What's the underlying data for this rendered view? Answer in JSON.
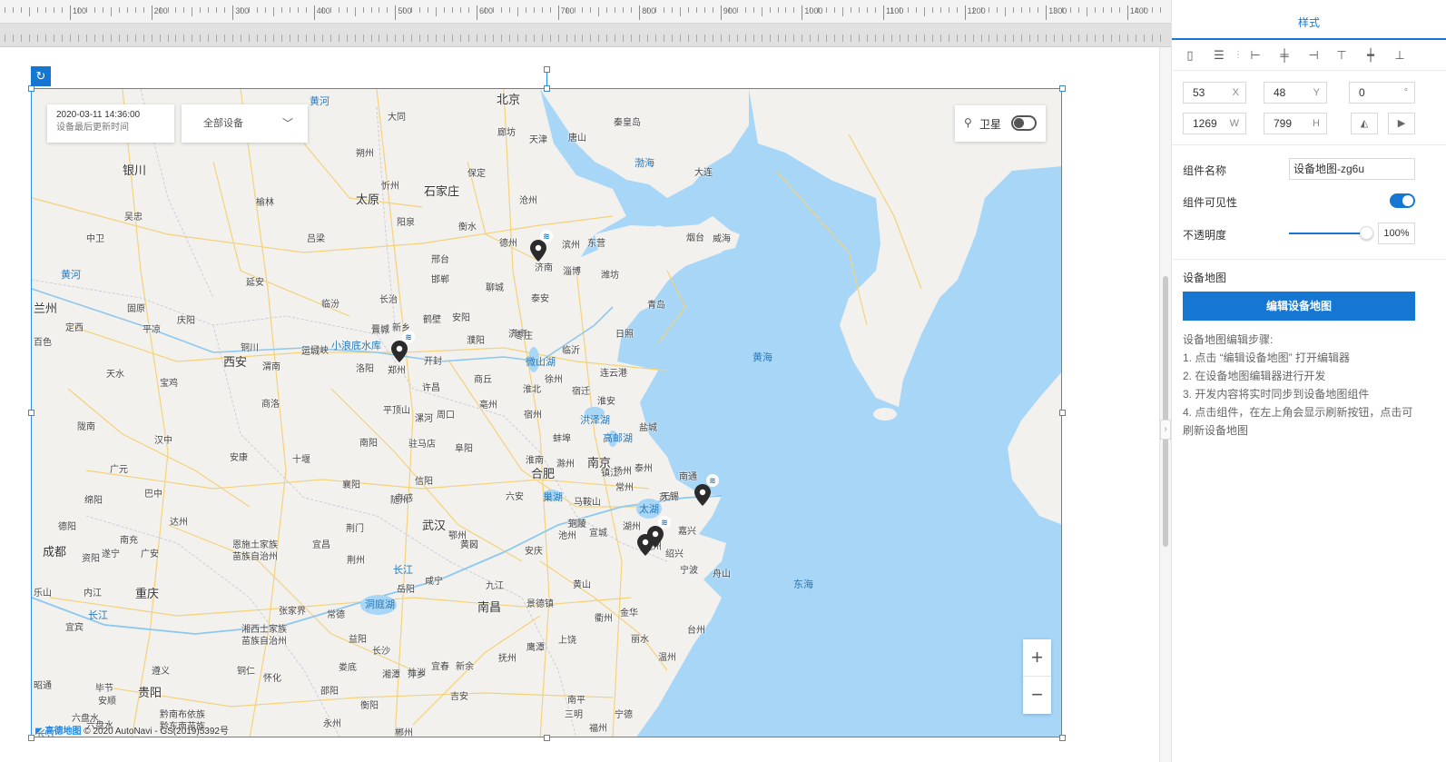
{
  "ruler": {
    "labels": [
      "100",
      "200",
      "300",
      "400",
      "500",
      "600",
      "700",
      "800",
      "900",
      "1000",
      "1100",
      "1200",
      "1300",
      "1400"
    ]
  },
  "map": {
    "info_time": "2020-03-11 14:36:00",
    "info_sub": "设备最后更新时间",
    "device_select": "全部设备",
    "satellite_label": "卫星",
    "satellite_on": false,
    "zoom_in": "+",
    "zoom_out": "−",
    "attribution_logo": "高德地图",
    "attribution_text": "© 2020 AutoNavi - GS(2019)5392号",
    "water_color": "#a7d6f7",
    "land_color": "#f2f1ee",
    "road_color": "#f4d27a",
    "pin_color": "#2b2b2b",
    "labels": {
      "beijing": "北京",
      "tianjin": "天津",
      "tangshan": "唐山",
      "qinhuangdao": "秦皇岛",
      "langfang": "廊坊",
      "baoding": "保定",
      "shijiazhuang": "石家庄",
      "cangzhou": "沧州",
      "taiyuan": "太原",
      "datong": "大同",
      "xinzhou": "忻州",
      "shuozhou": "朔州",
      "yangquan": "阳泉",
      "luliang": "吕梁",
      "yinchuan": "银川",
      "wuzhong": "吴忠",
      "yulin": "榆林",
      "yanan": "延安",
      "zhongwei": "中卫",
      "lanzhou": "兰州",
      "dingxi": "定西",
      "pingliang": "平凉",
      "qingyang": "庆阳",
      "guyuan": "固原",
      "tongchuan": "铜川",
      "xian": "西安",
      "weinan": "渭南",
      "tianshui": "天水",
      "baoji": "宝鸡",
      "shangluo": "商洛",
      "longnan": "陇南",
      "hanzhong": "汉中",
      "ankang": "安康",
      "guangyuan": "广元",
      "bazhong": "巴中",
      "mianyang": "绵阳",
      "dazhou": "达州",
      "nanchong": "南充",
      "guangan": "广安",
      "deyang": "德阳",
      "chengdu": "成都",
      "ziyang": "资阳",
      "suining": "遂宁",
      "leshan": "乐山",
      "neijiang": "内江",
      "chongqing": "重庆",
      "yibin": "宜宾",
      "zunyi": "遵义",
      "bijie": "毕节",
      "guiyang": "贵阳",
      "zhaotong": "昭通",
      "liupanshui": "六盘水",
      "qiannan": "黔南布依族",
      "tongren": "铜仁",
      "huaihua": "怀化",
      "shaoyang": "邵阳",
      "loudi": "娄底",
      "changsha": "长沙",
      "xiangtan": "湘潭",
      "zhuzhou": "株洲",
      "hengyang": "衡阳",
      "yongzhou": "永州",
      "chenzhou": "郴州",
      "pingxiang": "萍乡",
      "yichun": "宜春",
      "xinyu": "新余",
      "jian": "吉安",
      "ganzhou": "赣州",
      "fuzhou_jx": "抚州",
      "nanchang": "南昌",
      "jiujiang": "九江",
      "jingdezhen": "景德镇",
      "shangrao": "上饶",
      "yingtan": "鹰潭",
      "sanming": "三明",
      "nanping": "南平",
      "ningde": "宁德",
      "fuzhou": "福州",
      "lishui": "丽水",
      "wenzhou": "温州",
      "taizhou_zj": "台州",
      "jinhua": "金华",
      "quzhou": "衢州",
      "shaoxing": "绍兴",
      "ningbo": "宁波",
      "zhoushan": "舟山",
      "jiaxing": "嘉兴",
      "huzhou": "湖州",
      "hangzhou": "杭州",
      "shanghai": "上海",
      "suzhou": "苏州",
      "wuxi": "无锡",
      "changzhou": "常州",
      "zhenjiang": "镇江",
      "yangzhou": "扬州",
      "taizhou_js": "泰州",
      "nantong": "南通",
      "yancheng": "盐城",
      "huaian": "淮安",
      "lianyungang": "连云港",
      "suqian": "宿迁",
      "xuzhou": "徐州",
      "nanjing": "南京",
      "maanshan": "马鞍山",
      "wuhu": "芜湖",
      "xuancheng": "宣城",
      "tongling": "铜陵",
      "chizhou": "池州",
      "anqing": "安庆",
      "hefei": "合肥",
      "chuzhou": "滁州",
      "huainan": "淮南",
      "bengbu": "蚌埠",
      "huaibei": "淮北",
      "suzhou_ah": "宿州",
      "bozhou": "亳州",
      "fuyang": "阜阳",
      "luan": "六安",
      "huangshan": "黄山",
      "zhengzhou": "郑州",
      "kaifeng": "开封",
      "luoyang": "洛阳",
      "pingdingshan": "平顶山",
      "xuchang": "许昌",
      "luohe": "漯河",
      "zhoukou": "周口",
      "shangqiu": "商丘",
      "zhumadian": "驻马店",
      "nanyang": "南阳",
      "xinyang": "信阳",
      "sanmenxia": "三门峡",
      "jiaozuo": "焦作",
      "xinxiang": "新乡",
      "hebi": "鹤壁",
      "anyang": "安阳",
      "puyang": "濮阳",
      "heze": "菏泽",
      "jining": "济宁",
      "taian": "泰安",
      "jinan": "济南",
      "liaocheng": "聊城",
      "dezhou": "德州",
      "binzhou": "滨州",
      "dongying": "东营",
      "zibo": "淄博",
      "weifang": "潍坊",
      "qingdao": "青岛",
      "rizhao": "日照",
      "linyi": "临沂",
      "zaozhuang": "枣庄",
      "yantai": "烟台",
      "weihai": "威海",
      "dalian": "大连",
      "xingtai": "邢台",
      "handan": "邯郸",
      "changzhi": "长治",
      "jincheng": "晋城",
      "linfen": "临汾",
      "yuncheng": "运城",
      "wuhan": "武汉",
      "xiaogan": "孝感",
      "suizhou": "随州",
      "xiangyang": "襄阳",
      "shiyan": "十堰",
      "jingmen": "荆门",
      "yichang": "宜昌",
      "jingzhou": "荆州",
      "enshi": "恩施土家族",
      "enshi2": "苗族自治州",
      "xiangxi": "湘西土家族",
      "xiangxi2": "苗族自治州",
      "zhangjiajie": "张家界",
      "changde": "常德",
      "yiyang": "益阳",
      "yueyang": "岳阳",
      "xianning": "咸宁",
      "huangshi": "黄石",
      "huanggang": "黄冈",
      "ezhou": "鄂州",
      "hengshui": "衡水",
      "qianxinan": "黔东南苗族",
      "baise": "百色",
      "liupanshui2": "六盘水",
      "anshun": "安顺",
      "bohai": "渤海",
      "huanghai": "黄海",
      "donghai": "东海",
      "taihu": "太湖",
      "chaohu": "巢湖",
      "hongzehu": "洪泽湖",
      "gaoyouhu": "高邮湖",
      "weishanhu": "微山湖",
      "dongtinghu": "洞庭湖",
      "xiaolangdi": "小浪底水库",
      "huanghe": "黄河",
      "huanghe2": "黄河",
      "changjiang": "长江",
      "changjiang2": "长江",
      "changjiang3": "长江"
    }
  },
  "panel": {
    "tab": "样式",
    "x": "53",
    "x_suffix": "X",
    "y": "48",
    "y_suffix": "Y",
    "rotate": "0",
    "rotate_suffix": "°",
    "w": "1269",
    "w_suffix": "W",
    "h": "799",
    "h_suffix": "H",
    "name_label": "组件名称",
    "name_value": "设备地图-zg6u",
    "visible_label": "组件可见性",
    "visible_on": true,
    "opacity_label": "不透明度",
    "opacity_value": "100%",
    "opacity_fraction": 1.0,
    "section_title": "设备地图",
    "edit_button": "编辑设备地图",
    "steps": [
      "设备地图编辑步骤:",
      "1. 点击 “编辑设备地图” 打开编辑器",
      "2. 在设备地图编辑器进行开发",
      "3. 开发内容将实时同步到设备地图组件",
      "4. 点击组件，在左上角会显示刷新按钮，点击可刷新设备地图"
    ],
    "accent": "#1677d2"
  }
}
